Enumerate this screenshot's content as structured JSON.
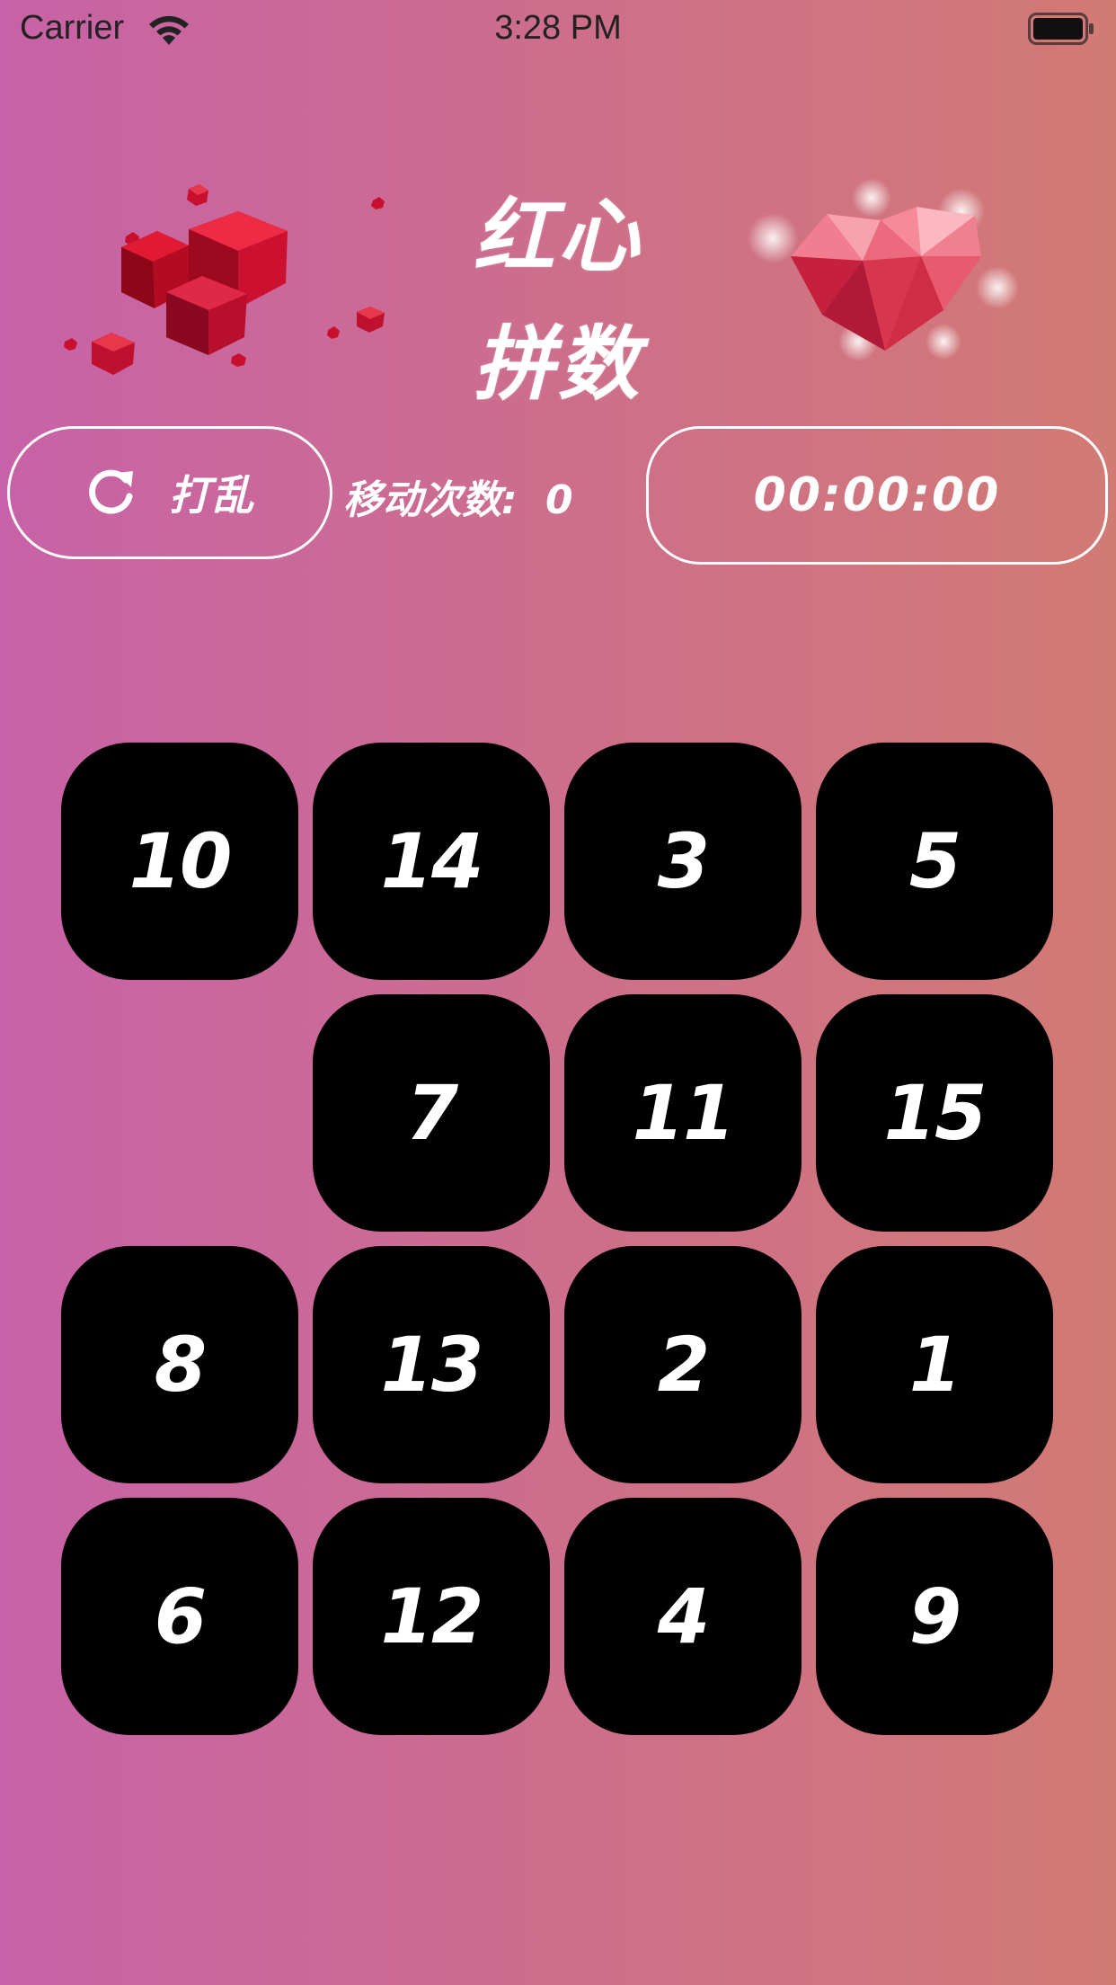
{
  "status_bar": {
    "carrier": "Carrier",
    "time": "3:28 PM",
    "icons": [
      "wifi-icon",
      "battery-icon"
    ]
  },
  "header": {
    "title_line1": "红心",
    "title_line2": "拼数",
    "left_art": "red-cubes-illustration",
    "right_art": "polygon-heart-illustration"
  },
  "controls": {
    "shuffle_label": "打乱",
    "shuffle_icon": "refresh-icon",
    "moves_label": "移动次数:",
    "moves_count": "0",
    "timer": "00:00:00"
  },
  "board": {
    "rows": [
      [
        "10",
        "14",
        "3",
        "5"
      ],
      [
        "",
        "7",
        "11",
        "15"
      ],
      [
        "8",
        "13",
        "2",
        "1"
      ],
      [
        "6",
        "12",
        "4",
        "9"
      ]
    ],
    "empty_position": [
      1,
      0
    ]
  },
  "colors": {
    "gradient_start": "#c862a8",
    "gradient_end": "#d27a74",
    "tile": "#000000",
    "text": "#ffffff"
  }
}
